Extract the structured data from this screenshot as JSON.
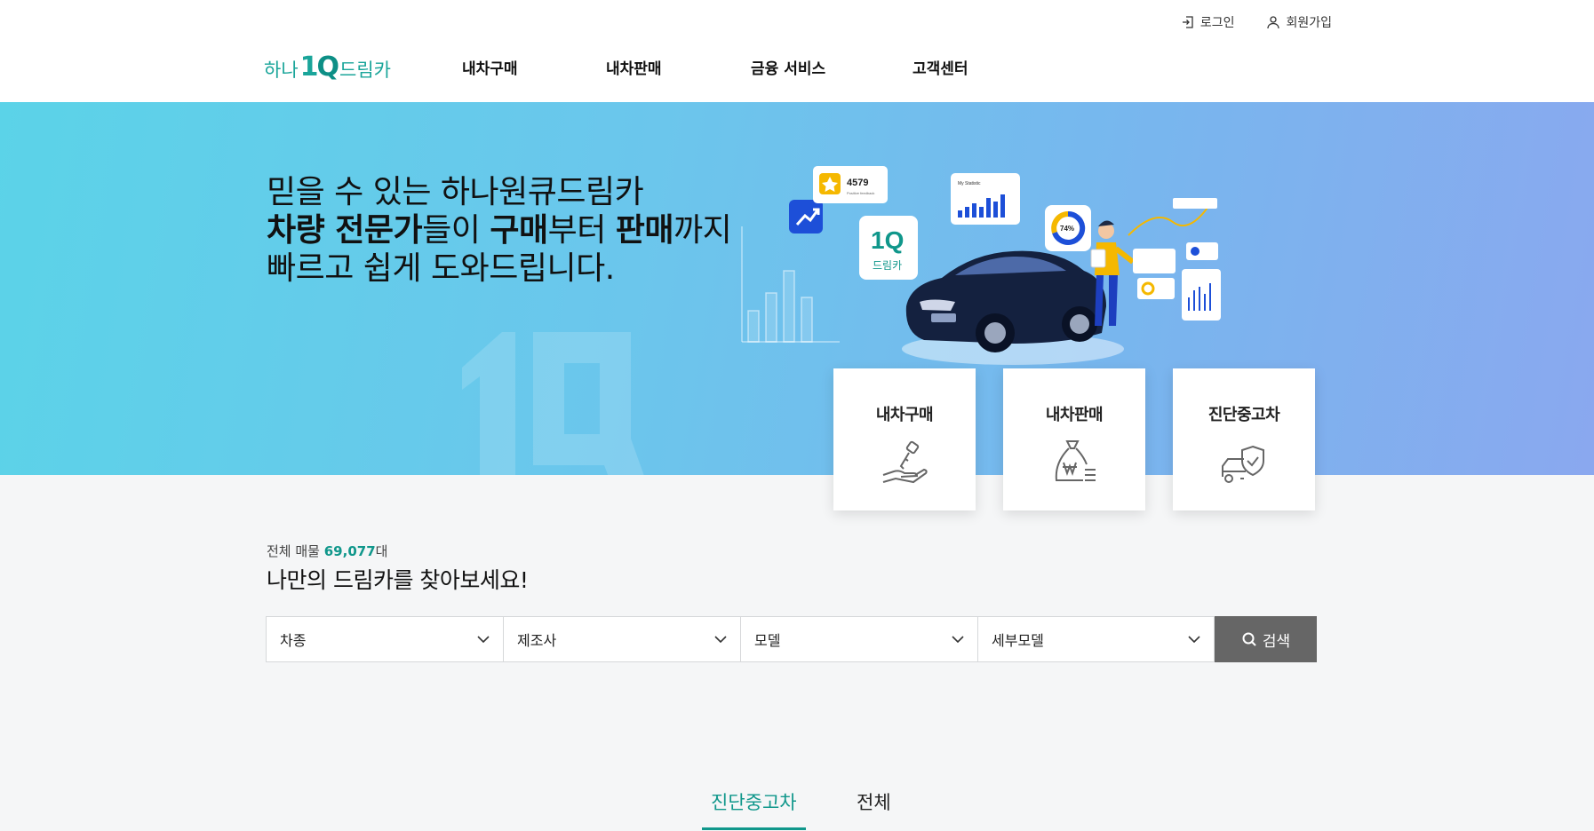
{
  "header": {
    "logo": {
      "prefix": "하나",
      "mark_one": "1",
      "mark_q": "Q",
      "suffix": "드림카"
    },
    "util": {
      "login": "로그인",
      "signup": "회원가입"
    },
    "gnb": [
      "내차구매",
      "내차판매",
      "금융 서비스",
      "고객센터"
    ]
  },
  "hero": {
    "line1": "믿을 수 있는 하나원큐드림카",
    "line2_b1": "차량 전문가",
    "line2_t1": "들이 ",
    "line2_b2": "구매",
    "line2_t2": "부터 ",
    "line2_b3": "판매",
    "line2_t3": "까지",
    "line3": "빠르고 쉽게 도와드립니다.",
    "art": {
      "feedback_count": "4579",
      "feedback_caption": "Positive feedback",
      "stat_title": "My Statistic",
      "percent": "74%",
      "badge_top": "1Q",
      "badge_bottom": "드림카"
    }
  },
  "quick": [
    {
      "label": "내차구매",
      "icon": "hand-key-icon"
    },
    {
      "label": "내차판매",
      "icon": "money-bag-icon"
    },
    {
      "label": "진단중고차",
      "icon": "car-shield-icon"
    }
  ],
  "search": {
    "count_prefix": "전체 매물 ",
    "count_value": "69,077",
    "count_suffix": "대",
    "headline": "나만의 드림카를 찾아보세요!",
    "selects": [
      "차종",
      "제조사",
      "모델",
      "세부모델"
    ],
    "button": "검색"
  },
  "tabs": [
    {
      "label": "진단중고차",
      "active": true
    },
    {
      "label": "전체",
      "active": false
    }
  ],
  "colors": {
    "accent": "#10978b",
    "search_button": "#666666"
  }
}
